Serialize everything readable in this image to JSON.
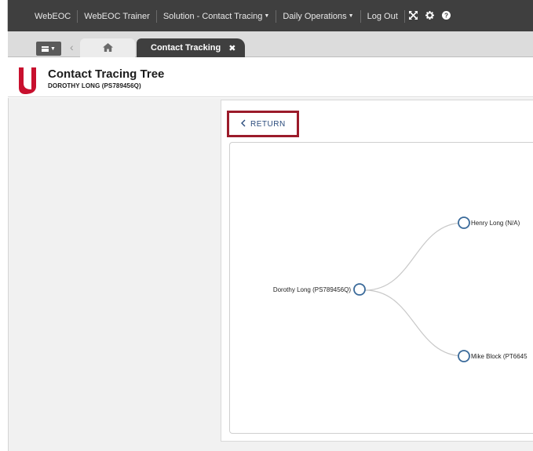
{
  "nav": {
    "items": [
      "WebEOC",
      "WebEOC Trainer",
      "Solution - Contact Tracing",
      "Daily Operations",
      "Log Out"
    ],
    "icons": [
      "expand-icon",
      "gear-icon",
      "help-icon"
    ]
  },
  "tabs": {
    "active_label": "Contact Tracking",
    "close_glyph": "✖",
    "home_glyph": "⌂"
  },
  "header": {
    "title": "Contact Tracing Tree",
    "subtitle": "DOROTHY LONG (PS789456Q)"
  },
  "panel": {
    "return_label": "RETURN"
  },
  "tree": {
    "root": "Dorothy Long (PS789456Q)",
    "children": [
      "Henry Long (N/A)",
      "Mike Block (PT6645"
    ]
  },
  "colors": {
    "nav_bg": "#3f3f3f",
    "accent_red": "#9b1b2a",
    "node_stroke": "#3a6a9a"
  }
}
